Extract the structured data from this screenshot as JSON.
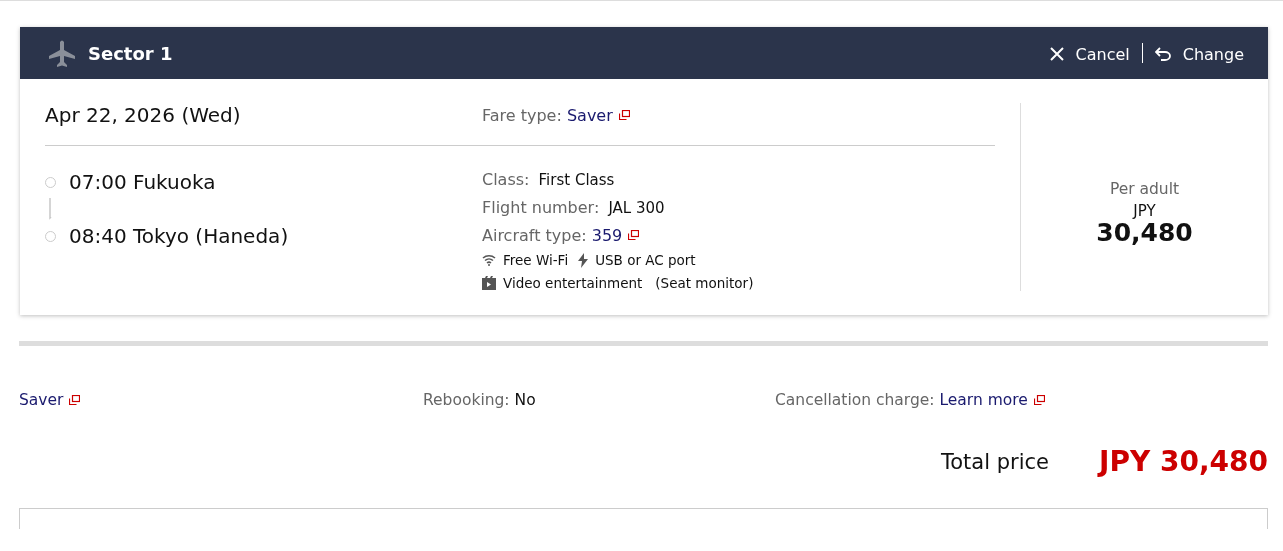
{
  "sector": {
    "title": "Sector 1",
    "actions": [
      {
        "kind": "cancel",
        "label": "Cancel"
      },
      {
        "kind": "change",
        "label": "Change"
      }
    ]
  },
  "flight": {
    "date": "Apr 22, 2026 (Wed)",
    "fare_type": {
      "label": "Fare type:",
      "value": "Saver"
    },
    "stops": [
      {
        "time_place": "07:00 Fukuoka"
      },
      {
        "time_place": "08:40 Tokyo (Haneda)"
      }
    ],
    "details": [
      {
        "kind": "text",
        "label": "Class:",
        "value": "First Class"
      },
      {
        "kind": "text",
        "label": "Flight number:",
        "value": "JAL 300"
      },
      {
        "kind": "link",
        "label": "Aircraft type:",
        "value": "359"
      }
    ],
    "amenities": [
      [
        {
          "kind": "wifi",
          "label": "Free Wi-Fi"
        },
        {
          "kind": "power",
          "label": "USB or AC port"
        }
      ],
      [
        {
          "kind": "video",
          "label": "Video entertainment",
          "note": "(Seat monitor)"
        }
      ]
    ]
  },
  "price": {
    "label": "Per adult",
    "currency": "JPY",
    "amount": "30,480"
  },
  "fare_rules": {
    "fare": "Saver",
    "rebooking": {
      "label": "Rebooking:",
      "value": "No"
    },
    "cancellation": {
      "label": "Cancellation charge:",
      "link": "Learn more"
    }
  },
  "total": {
    "label": "Total price",
    "value": "JPY 30,480"
  }
}
